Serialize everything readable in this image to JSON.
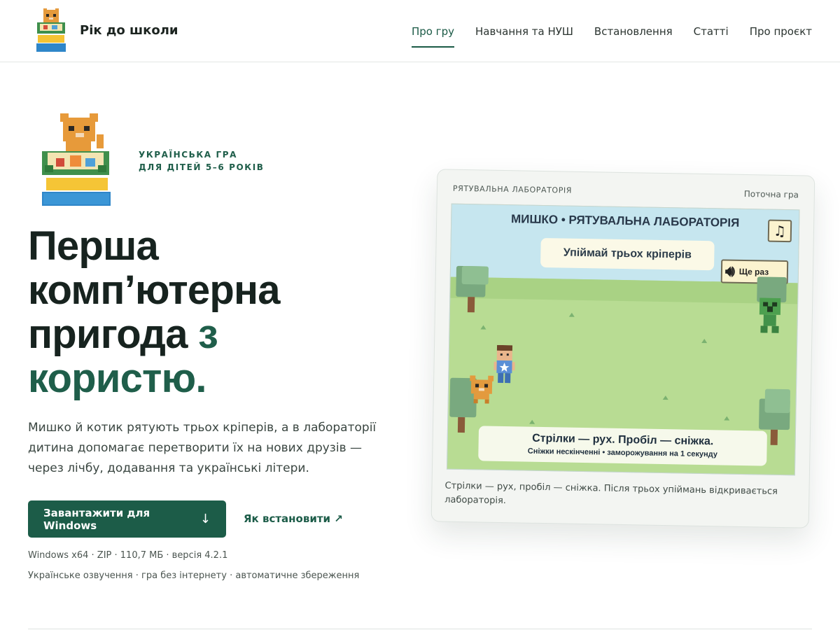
{
  "header": {
    "brand_name": "Рік до школи",
    "nav": [
      {
        "label": "Про гру",
        "active": true
      },
      {
        "label": "Навчання та НУШ",
        "active": false
      },
      {
        "label": "Встановлення",
        "active": false
      },
      {
        "label": "Статті",
        "active": false
      },
      {
        "label": "Про проєкт",
        "active": false
      }
    ],
    "logo_text": "Рік до школи"
  },
  "hero": {
    "eyebrow_line1": "УКРАЇНСЬКА ГРА",
    "eyebrow_line2": "ДЛЯ ДІТЕЙ 5–6 РОКІВ",
    "title_line1": "Перша",
    "title_line2": "комп’ютерна",
    "title_line3_plain": "пригода ",
    "title_line3_accent": "з",
    "title_line4_accent": "користю.",
    "description": "Мишко й котик рятують трьох кріперів, а в лабораторії дитина допомагає перетворити їх на нових друзів — через лічбу, додавання та українські літери.",
    "download_label": "Завантажити для Windows",
    "download_icon": "arrow-down-icon",
    "install_link_label": "Як встановити ↗",
    "meta_line1": "Windows x64 · ZIP · 110,7 МБ · версія 4.2.1",
    "meta_line2": "Українське озвучення · гра без інтернету · автоматичне збереження"
  },
  "game_card": {
    "label": "РЯТУВАЛЬНА ЛАБОРАТОРІЯ",
    "tag": "Поточна гра",
    "game_title": "МИШКО • РЯТУВАЛЬНА ЛАБОРАТОРІЯ",
    "task": "Упіймай трьох кріперів",
    "repeat_label": "Ще раз",
    "music_icon": "music-note-icon",
    "hint_main": "Стрілки — рух. Пробіл — сніжка.",
    "hint_sub": "Сніжки нескінченні • заморожування на 1 секунду",
    "caption": "Стрілки — рух, пробіл — сніжка. Після трьох упіймань відкривається лабораторія."
  },
  "colors": {
    "accent": "#1c5c48",
    "text": "#17231f",
    "muted": "#4b5550"
  }
}
